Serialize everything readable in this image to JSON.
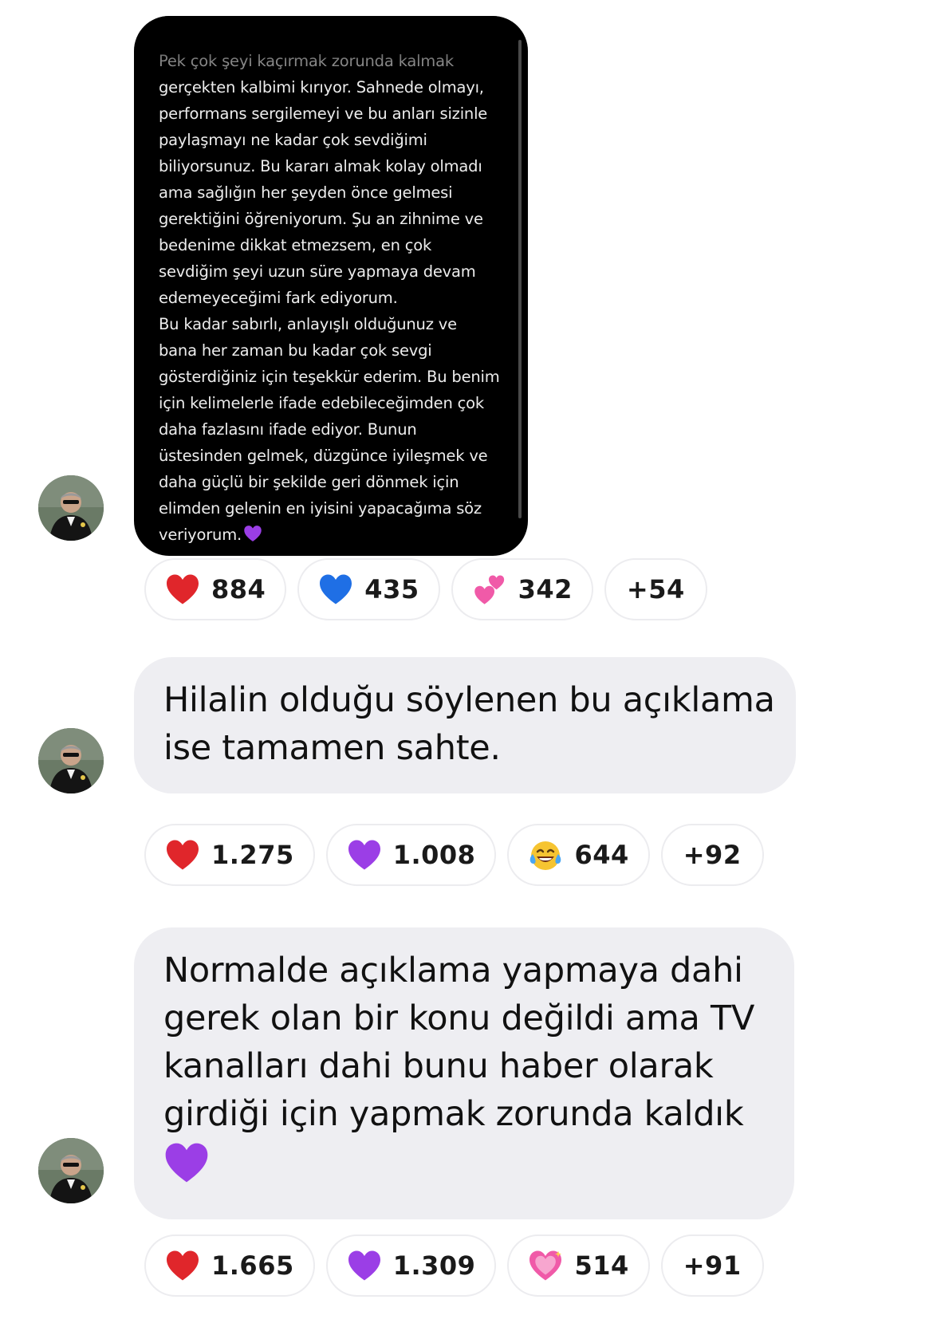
{
  "messages": [
    {
      "type": "image",
      "screenshot_lines": [
        "Pek çok şeyi kaçırmak zorunda kalmak",
        "gerçekten kalbimi kırıyor. Sahnede olmayı,",
        "performans sergilemeyi ve bu anları sizinle",
        "paylaşmayı ne kadar çok sevdiğimi",
        "biliyorsunuz. Bu kararı almak kolay olmadı",
        "ama sağlığın her şeyden önce gelmesi",
        "gerektiğini öğreniyorum. Şu an zihnime ve",
        "bedenime dikkat etmezsem, en çok",
        "sevdiğim şeyi uzun süre yapmaya devam",
        "edemeyeceğimi fark ediyorum.",
        "Bu kadar sabırlı, anlayışlı olduğunuz ve",
        "bana her zaman bu kadar çok sevgi",
        "gösterdiğiniz için teşekkür ederim. Bu benim",
        "için kelimelerle ifade edebileceğimden çok",
        "daha fazlasını ifade ediyor. Bunun",
        "üstesinden gelmek, düzgünce iyileşmek ve",
        "daha güçlü bir şekilde geri dönmek için",
        "elimden gelenin en iyisini yapacağıma söz",
        "veriyorum."
      ],
      "screenshot_end_icon": "purple-heart-icon",
      "reactions": [
        {
          "icon": "red-heart-icon",
          "count": "884"
        },
        {
          "icon": "blue-heart-icon",
          "count": "435"
        },
        {
          "icon": "two-hearts-icon",
          "count": "342"
        }
      ],
      "more": "+54"
    },
    {
      "type": "text",
      "lines": [
        "Hilalin olduğu söylenen bu açıklama",
        "ise tamamen sahte."
      ],
      "reactions": [
        {
          "icon": "red-heart-icon",
          "count": "1.275"
        },
        {
          "icon": "purple-heart-icon",
          "count": "1.008"
        },
        {
          "icon": "tears-of-joy-icon",
          "count": "644"
        }
      ],
      "more": "+92"
    },
    {
      "type": "text",
      "lines": [
        "Normalde açıklama yapmaya dahi",
        "gerek olan bir konu değildi ama TV",
        "kanalları dahi bunu haber olarak",
        "girdiği için yapmak zorunda kaldık"
      ],
      "end_icon": "purple-heart-icon",
      "reactions": [
        {
          "icon": "red-heart-icon",
          "count": "1.665"
        },
        {
          "icon": "purple-heart-icon",
          "count": "1.309"
        },
        {
          "icon": "sparkling-heart-icon",
          "count": "514"
        }
      ],
      "more": "+91"
    }
  ],
  "colors": {
    "bubble_bg": "#eeeef2",
    "screenshot_bg": "#000000",
    "red_heart": "#e0262b",
    "blue_heart": "#1f6fe5",
    "purple_heart": "#9b3ee6",
    "pink_heart": "#f05aa8"
  }
}
